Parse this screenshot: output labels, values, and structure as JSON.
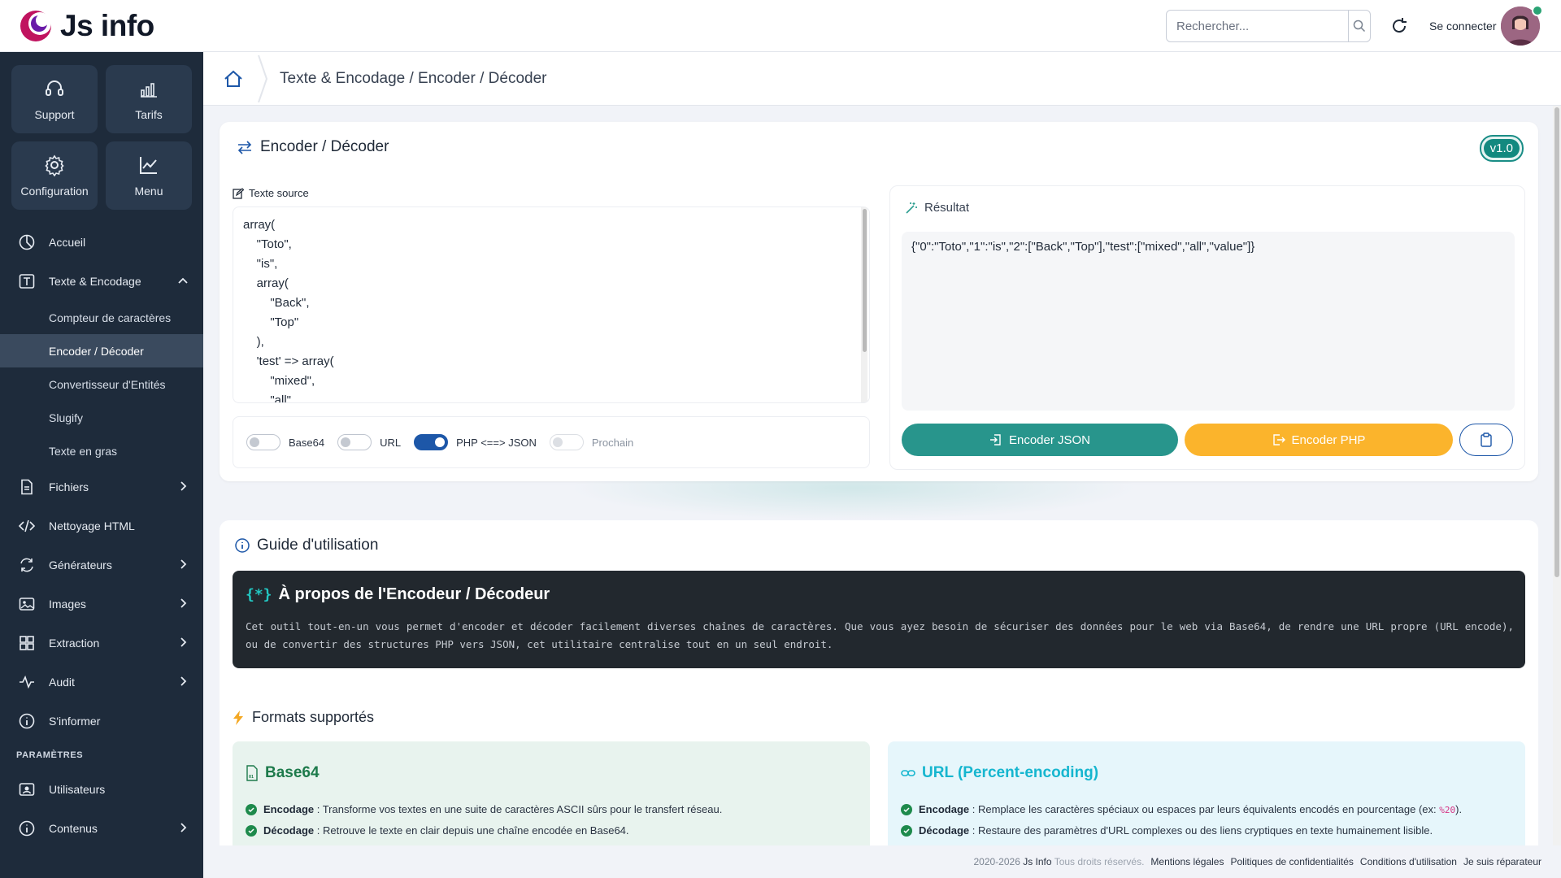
{
  "app": {
    "name": "Js info"
  },
  "header": {
    "search_placeholder": "Rechercher...",
    "login_label": "Se connecter"
  },
  "sidebar": {
    "tiles": [
      {
        "label": "Support",
        "icon": "headset-icon"
      },
      {
        "label": "Tarifs",
        "icon": "bar-chart-icon"
      },
      {
        "label": "Configuration",
        "icon": "gear-icon"
      },
      {
        "label": "Menu",
        "icon": "trend-chart-icon"
      }
    ],
    "items": {
      "accueil": "Accueil",
      "texte": "Texte & Encodage",
      "sub": [
        "Compteur de caractères",
        "Encoder / Décoder",
        "Convertisseur d'Entités",
        "Slugify",
        "Texte en gras"
      ],
      "fichiers": "Fichiers",
      "nettoyage": "Nettoyage HTML",
      "generateurs": "Générateurs",
      "images": "Images",
      "extraction": "Extraction",
      "audit": "Audit",
      "sinformer": "S'informer",
      "section_params": "PARAMÈTRES",
      "utilisateurs": "Utilisateurs",
      "contenus": "Contenus"
    }
  },
  "breadcrumb": {
    "text": "Texte & Encodage / Encoder / Décoder"
  },
  "tool": {
    "title": "Encoder / Décoder",
    "version": "v1.0",
    "source_label": "Texte source",
    "source_text": "array(\n    \"Toto\",\n    \"is\",\n    array(\n        \"Back\",\n        \"Top\"\n    ),\n    'test' => array(\n        \"mixed\",\n        \"all\",",
    "options": {
      "base64": "Base64",
      "url": "URL",
      "phpjson": "PHP <==> JSON",
      "prochain": "Prochain"
    },
    "result_label": "Résultat",
    "result_text": "{\"0\":\"Toto\",\"1\":\"is\",\"2\":[\"Back\",\"Top\"],\"test\":[\"mixed\",\"all\",\"value\"]}",
    "btn_json": "Encoder JSON",
    "btn_php": "Encoder PHP"
  },
  "guide": {
    "title": "Guide d'utilisation",
    "about_title": "À propos de l'Encodeur / Décodeur",
    "about_desc": "Cet outil tout-en-un vous permet d'encoder et décoder facilement diverses chaînes de caractères. Que vous ayez besoin de sécuriser des données pour le web via Base64, de rendre une URL propre (URL encode), ou de convertir des structures PHP vers JSON, cet utilitaire centralise tout en un seul endroit.",
    "formats_title": "Formats supportés",
    "base64": {
      "name": "Base64",
      "enc_label": "Encodage",
      "enc_text": " : Transforme vos textes en une suite de caractères ASCII sûrs pour le transfert réseau.",
      "dec_label": "Décodage",
      "dec_text": " : Retrouve le texte en clair depuis une chaîne encodée en Base64."
    },
    "url": {
      "name": "URL (Percent-encoding)",
      "enc_label": "Encodage",
      "enc_text": " : Remplace les caractères spéciaux ou espaces par leurs équivalents encodés en pourcentage (ex: ",
      "enc_code": "%20",
      "enc_tail": ").",
      "dec_label": "Décodage",
      "dec_text": " : Restaure des paramètres d'URL complexes ou des liens cryptiques en texte humainement lisible."
    }
  },
  "footer": {
    "copyright": "2020-2026",
    "brand": "Js Info",
    "rights": "Tous droits réservés.",
    "links": [
      "Mentions légales",
      "Politiques de confidentialités",
      "Conditions d'utilisation",
      "Je suis réparateur"
    ]
  },
  "colors": {
    "sidebar_bg": "#1e2b3b",
    "teal": "#28958c",
    "amber": "#fbb42c",
    "primary_blue": "#1d57a8"
  }
}
